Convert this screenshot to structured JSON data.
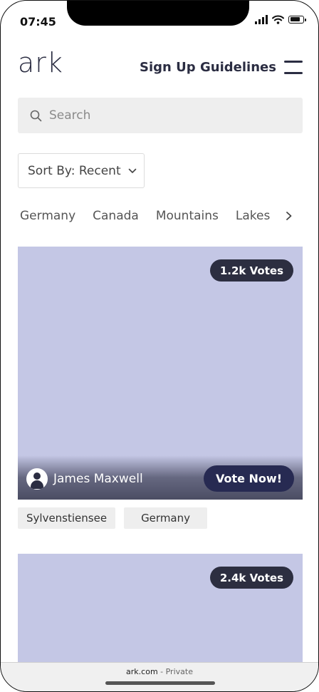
{
  "status_bar": {
    "time": "07:45"
  },
  "header": {
    "logo": "ark",
    "nav": {
      "sign_up": "Sign Up",
      "guidelines": "Guidelines"
    }
  },
  "search": {
    "placeholder": "Search"
  },
  "sort": {
    "label": "Sort By: Recent"
  },
  "categories": [
    "Germany",
    "Canada",
    "Mountains",
    "Lakes"
  ],
  "posts": [
    {
      "votes": "1.2k Votes",
      "author": "James Maxwell",
      "vote_label": "Vote Now!",
      "tags": [
        "Sylvenstiensee",
        "Germany"
      ],
      "image_color": "#c4c7e5"
    },
    {
      "votes": "2.4k Votes",
      "image_color": "#c4c7e5"
    }
  ],
  "browser": {
    "domain": "ark.com",
    "mode": " - Private"
  },
  "colors": {
    "brand": "#2b2d42",
    "vote_button": "#272a52",
    "badge": "#2c2e40"
  }
}
